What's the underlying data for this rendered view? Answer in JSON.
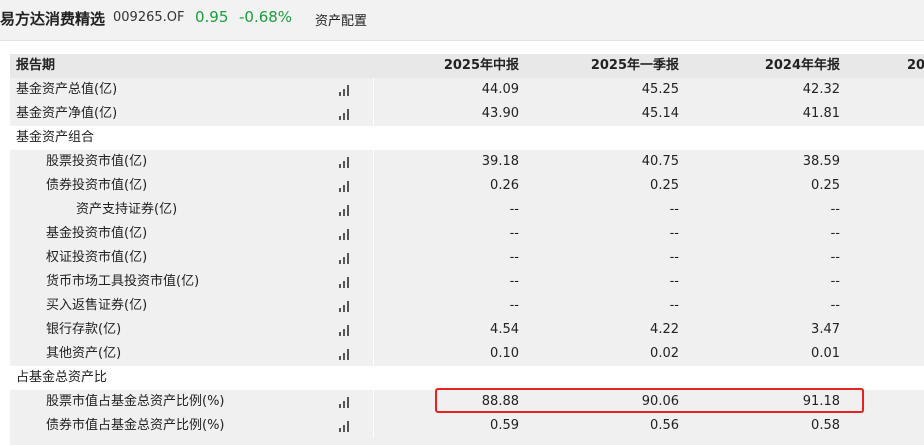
{
  "header": {
    "fund_name": "易方达消费精选",
    "fund_code": "009265.OF",
    "nav": "0.95",
    "change": "-0.68%",
    "tab": "资产配置"
  },
  "table": {
    "columns": [
      "报告期",
      "2025年中报",
      "2025年一季报",
      "2024年年报",
      "20"
    ],
    "rows": [
      {
        "label": "基金资产总值(亿)",
        "values": [
          "44.09",
          "45.25",
          "42.32"
        ],
        "icon": "bar-chart-icon"
      },
      {
        "label": "基金资产净值(亿)",
        "values": [
          "43.90",
          "45.14",
          "41.81"
        ],
        "icon": "bar-chart-icon"
      },
      {
        "label": "基金资产组合",
        "values": [
          "",
          "",
          ""
        ]
      },
      {
        "label": "股票投资市值(亿)",
        "values": [
          "39.18",
          "40.75",
          "38.59"
        ],
        "icon": "bar-chart-icon"
      },
      {
        "label": "债券投资市值(亿)",
        "values": [
          "0.26",
          "0.25",
          "0.25"
        ],
        "icon": "bar-chart-icon"
      },
      {
        "label": "资产支持证券(亿)",
        "values": [
          "--",
          "--",
          "--"
        ],
        "icon": "bar-chart-icon"
      },
      {
        "label": "基金投资市值(亿)",
        "values": [
          "--",
          "--",
          "--"
        ],
        "icon": "bar-chart-icon"
      },
      {
        "label": "权证投资市值(亿)",
        "values": [
          "--",
          "--",
          "--"
        ],
        "icon": "bar-chart-icon"
      },
      {
        "label": "货币市场工具投资市值(亿)",
        "values": [
          "--",
          "--",
          "--"
        ],
        "icon": "bar-chart-icon"
      },
      {
        "label": "买入返售证券(亿)",
        "values": [
          "--",
          "--",
          "--"
        ],
        "icon": "bar-chart-icon"
      },
      {
        "label": "银行存款(亿)",
        "values": [
          "4.54",
          "4.22",
          "3.47"
        ],
        "icon": "bar-chart-icon"
      },
      {
        "label": "其他资产(亿)",
        "values": [
          "0.10",
          "0.02",
          "0.01"
        ],
        "icon": "bar-chart-icon"
      },
      {
        "label": "占基金总资产比",
        "values": [
          "",
          "",
          ""
        ]
      },
      {
        "label": "股票市值占基金总资产比例(%)",
        "values": [
          "88.88",
          "90.06",
          "91.18"
        ],
        "icon": "bar-chart-icon"
      },
      {
        "label": "债券市值占基金总资产比例(%)",
        "values": [
          "0.59",
          "0.56",
          "0.58"
        ],
        "icon": "bar-chart-icon"
      }
    ]
  },
  "highlight_color": "#e8231f",
  "positive_color": "#1a9e3d"
}
